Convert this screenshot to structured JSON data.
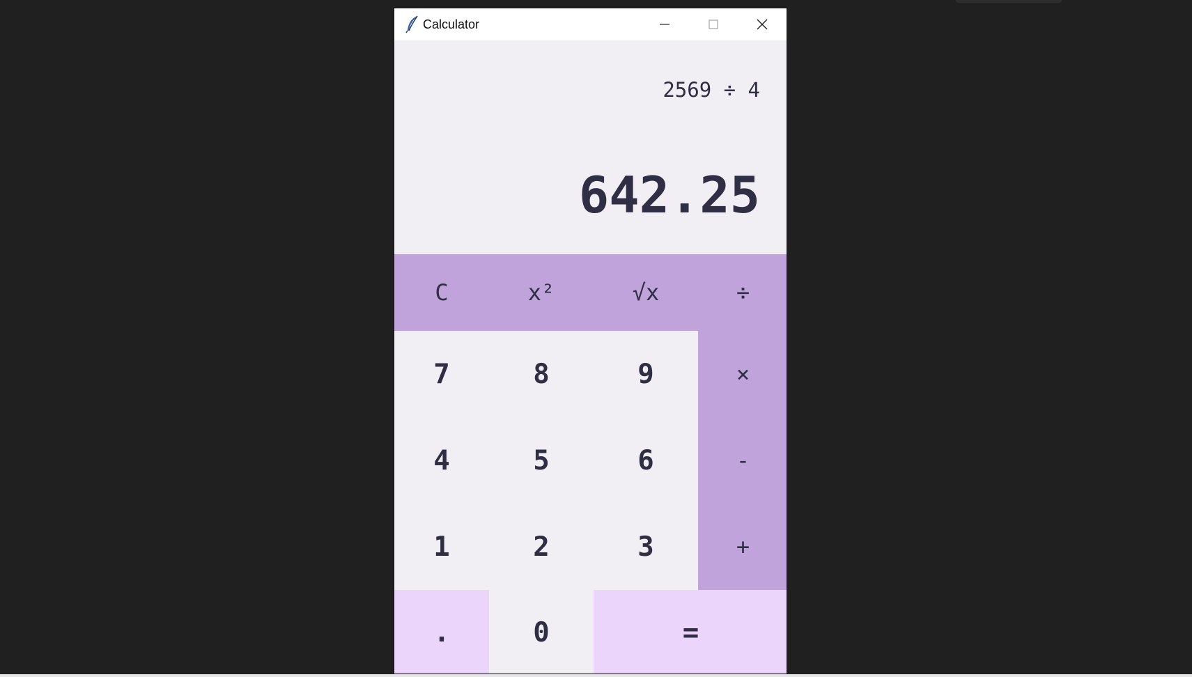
{
  "window": {
    "title": "Calculator",
    "icon": "feather-icon"
  },
  "display": {
    "expression": "2569 ÷ 4",
    "result": "642.25"
  },
  "keys": {
    "clear": "C",
    "square": "x²",
    "sqrt": "√x",
    "divide": "÷",
    "seven": "7",
    "eight": "8",
    "nine": "9",
    "multiply": "×",
    "four": "4",
    "five": "5",
    "six": "6",
    "subtract": "-",
    "one": "1",
    "two": "2",
    "three": "3",
    "add": "+",
    "decimal": ".",
    "zero": "0",
    "equals": "="
  },
  "colors": {
    "operator_bg": "#c1a3dc",
    "number_bg": "#f1eff4",
    "accent_bg": "#ecd5fb",
    "text": "#2f2e44",
    "desktop_bg": "#202020"
  }
}
